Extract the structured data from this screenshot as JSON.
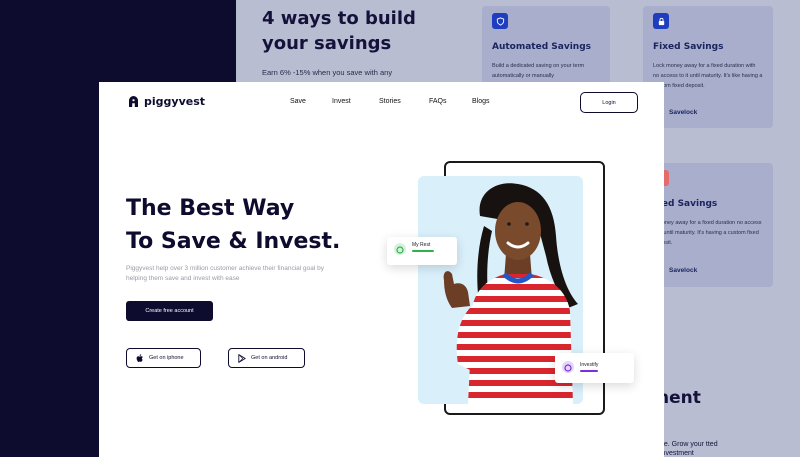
{
  "background": {
    "heading": "4 ways to build your savings",
    "subtext": "Earn 6% -15% when you save with any",
    "cards": [
      {
        "title": "Automated Savings",
        "text": "Build a dedicated saving on your term automatically or manually",
        "link": ""
      },
      {
        "title": "Fixed Savings",
        "text": "Lock money away for a fixed duration with no access to it until maturity. It's like having a custom fixed deposit.",
        "link": "Savelock"
      },
      {
        "title": "ixed Savings",
        "text": "k money away for a fixed duration no access to it until maturity. It's having a custom fixed deposit.",
        "link": "Savelock"
      }
    ],
    "partial_heading": "nent",
    "partial_text": "ge. Grow your tted investment"
  },
  "nav": {
    "brand": "piggyvest",
    "items": [
      "Save",
      "Invest",
      "Stories",
      "FAQs",
      "Blogs"
    ],
    "login": "Login"
  },
  "hero": {
    "title_line1": "The Best Way",
    "title_line2": "To Save & Invest.",
    "description": "Piggyvest help over 3 million customer achieve their financial goal by helping them save and invest with ease",
    "cta": "Create free account",
    "ios": "Get on iphone",
    "android": "Get on android"
  },
  "floating_cards": {
    "rest": {
      "label": "My Rest",
      "progress": 0.6,
      "color": "#2fb24c"
    },
    "invest": {
      "label": "Investify",
      "progress": 0.5,
      "color": "#7a2fe0"
    }
  },
  "colors": {
    "primary": "#0d0b2e",
    "bg_overlay": "#b9bdd2"
  }
}
